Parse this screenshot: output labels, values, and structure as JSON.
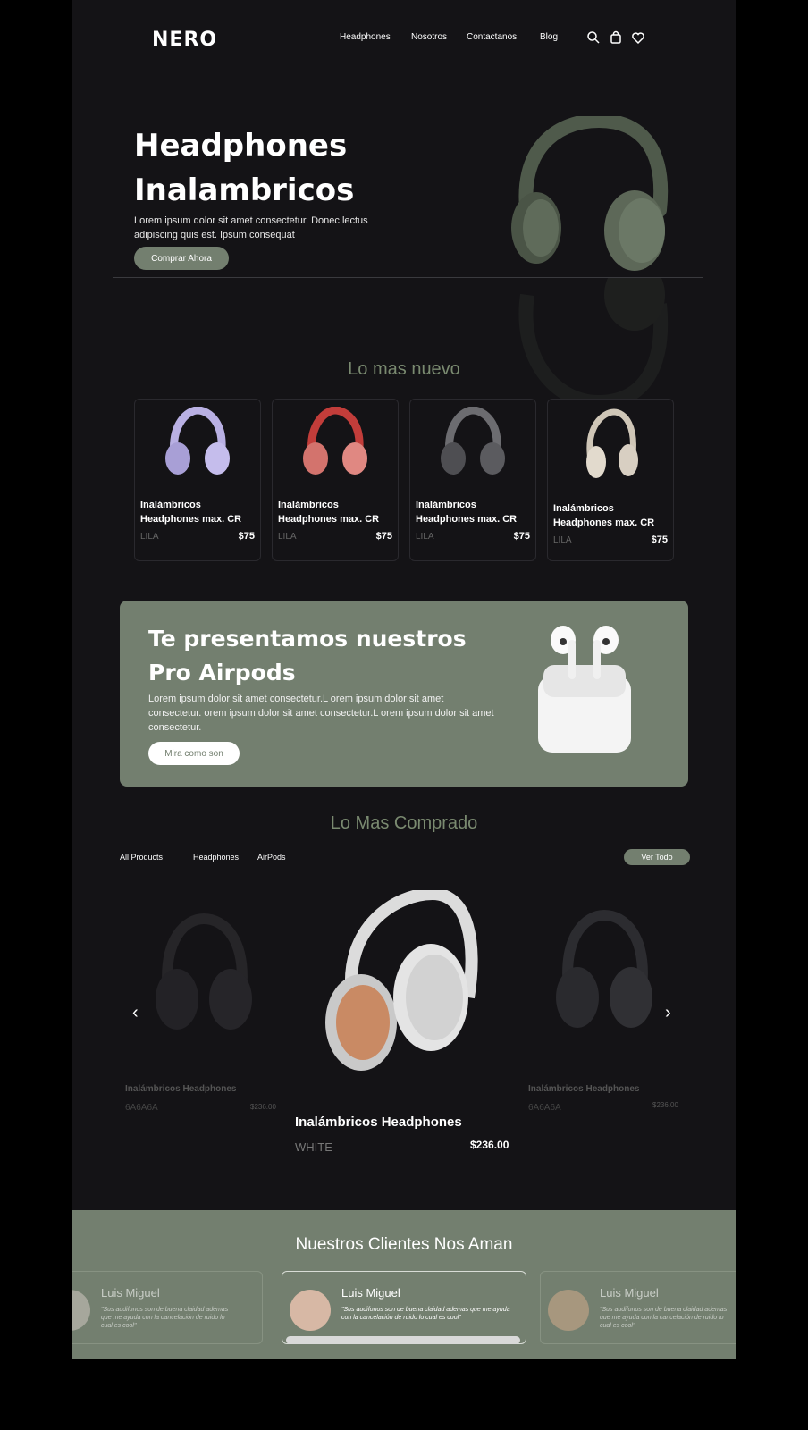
{
  "nav": {
    "logo": "NERO",
    "links": [
      "Headphones",
      "Nosotros",
      "Contactanos",
      "Blog"
    ]
  },
  "hero": {
    "title": "Headphones Inalambricos",
    "description": "Lorem ipsum dolor sit amet consectetur. Donec lectus adipiscing quis est. Ipsum consequat",
    "button": "Comprar Ahora"
  },
  "newest": {
    "title": "Lo mas nuevo",
    "products": [
      {
        "name": "Inalámbricos Headphones max. CR",
        "color": "LILA",
        "price": "$75",
        "tint": "#b9b0e3"
      },
      {
        "name": "Inalámbricos Headphones max. CR",
        "color": "LILA",
        "price": "$75",
        "tint": "#e08882"
      },
      {
        "name": "Inalámbricos Headphones max. CR",
        "color": "LILA",
        "price": "$75",
        "tint": "#5b5b5f"
      },
      {
        "name": "Inalámbricos Headphones max. CR",
        "color": "LILA",
        "price": "$75",
        "tint": "#d8cfc2"
      }
    ]
  },
  "promo": {
    "title": "Te presentamos nuestros Pro Airpods",
    "description": "Lorem ipsum dolor sit amet consectetur.L orem ipsum dolor sit amet consectetur. orem ipsum dolor sit amet consectetur.L orem ipsum dolor sit amet consectetur.",
    "button": "Mira como son"
  },
  "best": {
    "title": "Lo Mas Comprado",
    "tabs": [
      "All Products",
      "Headphones",
      "AirPods"
    ],
    "see_all": "Ver Todo",
    "left": {
      "name": "Inalámbricos Headphones",
      "color": "6A6A6A",
      "price": "$236.00"
    },
    "center": {
      "name": "Inalámbricos Headphones",
      "color": "WHITE",
      "price": "$236.00"
    },
    "right": {
      "name": "Inalámbricos Headphones",
      "color": "6A6A6A",
      "price": "$236.00"
    }
  },
  "testimonials": {
    "title": "Nuestros Clientes Nos Aman",
    "items": [
      {
        "name": "Luis Miguel",
        "quote": "\"Sus audifonos son de buena claidad ademas que me ayuda con la cancelación de ruido lo cual es cool\""
      },
      {
        "name": "Luis Miguel",
        "quote": "\"Sus audifonos son de buena claidad ademas que me ayuda con la cancelación de ruido lo cual es cool\""
      },
      {
        "name": "Luis Miguel",
        "quote": "\"Sus audifonos son de buena claidad ademas que me ayuda con la cancelación de ruido lo cual es cool\""
      }
    ]
  },
  "colors": {
    "accent": "#737f6f",
    "bg": "#141316",
    "title_green": "#7a8a70"
  }
}
